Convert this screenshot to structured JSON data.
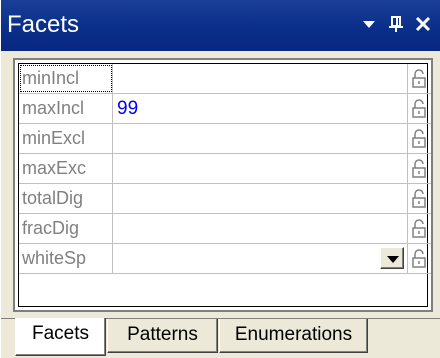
{
  "panel": {
    "title": "Facets",
    "menu_glyph": "▾",
    "pin_glyph": "ꟼ",
    "close_glyph": "✕"
  },
  "facets": [
    {
      "name": "minIncl",
      "value": "",
      "focused": true
    },
    {
      "name": "maxIncl",
      "value": "99"
    },
    {
      "name": "minExcl",
      "value": ""
    },
    {
      "name": "maxExc",
      "value": ""
    },
    {
      "name": "totalDig",
      "value": ""
    },
    {
      "name": "fracDig",
      "value": ""
    },
    {
      "name": "whiteSp",
      "value": "",
      "has_dropdown": true
    }
  ],
  "tabs": [
    {
      "label": "Facets",
      "active": true
    },
    {
      "label": "Patterns",
      "active": false
    },
    {
      "label": "Enumerations",
      "active": false
    }
  ],
  "colors": {
    "titlebar": "#0a2f8a",
    "value_text": "#0000ff",
    "label_text": "#808080"
  }
}
